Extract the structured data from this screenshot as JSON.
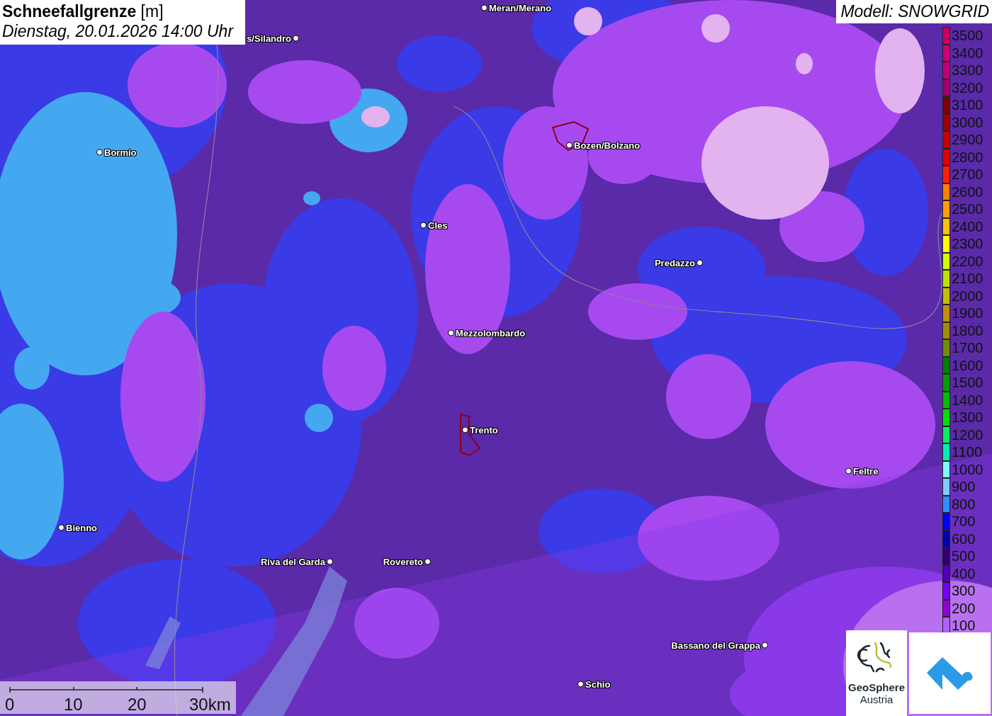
{
  "title": {
    "heading": "**Schneefallgrenze** [m]",
    "datetime": "Dienstag, 20.01.2026 14:00 Uhr"
  },
  "model": "Modell: SNOWGRID",
  "legend": [
    {
      "label": "3500",
      "color": "#c8005a"
    },
    {
      "label": "3400",
      "color": "#d0006e"
    },
    {
      "label": "3300",
      "color": "#c00070"
    },
    {
      "label": "3200",
      "color": "#a00070"
    },
    {
      "label": "3100",
      "color": "#800000"
    },
    {
      "label": "3000",
      "color": "#a00000"
    },
    {
      "label": "2900",
      "color": "#c80000"
    },
    {
      "label": "2800",
      "color": "#e00000"
    },
    {
      "label": "2700",
      "color": "#ff2000"
    },
    {
      "label": "2600",
      "color": "#ff8000"
    },
    {
      "label": "2500",
      "color": "#ffa000"
    },
    {
      "label": "2400",
      "color": "#ffc000"
    },
    {
      "label": "2300",
      "color": "#ffff00"
    },
    {
      "label": "2200",
      "color": "#d0ff00"
    },
    {
      "label": "2100",
      "color": "#c0e000"
    },
    {
      "label": "2000",
      "color": "#c0c000"
    },
    {
      "label": "1900",
      "color": "#c09000"
    },
    {
      "label": "1800",
      "color": "#a09000"
    },
    {
      "label": "1700",
      "color": "#709000"
    },
    {
      "label": "1600",
      "color": "#008000"
    },
    {
      "label": "1500",
      "color": "#00a000"
    },
    {
      "label": "1400",
      "color": "#00c000"
    },
    {
      "label": "1300",
      "color": "#00e000"
    },
    {
      "label": "1200",
      "color": "#00f060"
    },
    {
      "label": "1100",
      "color": "#00f0b0"
    },
    {
      "label": "1000",
      "color": "#80ffff"
    },
    {
      "label": "900",
      "color": "#80c8ff"
    },
    {
      "label": "800",
      "color": "#3090ff"
    },
    {
      "label": "700",
      "color": "#0000ff"
    },
    {
      "label": "600",
      "color": "#0000b0"
    },
    {
      "label": "500",
      "color": "#300070"
    },
    {
      "label": "400",
      "color": "#5000b0"
    },
    {
      "label": "300",
      "color": "#7000ff"
    },
    {
      "label": "200",
      "color": "#9000d0"
    },
    {
      "label": "100",
      "color": "#b060ff"
    }
  ],
  "cities": [
    {
      "name": "Meran/Merano",
      "kind": "label-right"
    },
    {
      "name": "s/Silandro",
      "kind": "label-left"
    },
    {
      "name": "Bormio",
      "kind": "label-right"
    },
    {
      "name": "Bozen/Bolzano",
      "kind": "label-right"
    },
    {
      "name": "Cles",
      "kind": "label-right"
    },
    {
      "name": "Predazzo",
      "kind": "label-left"
    },
    {
      "name": "Mezzolombardo",
      "kind": "label-right"
    },
    {
      "name": "Trento",
      "kind": "label-right"
    },
    {
      "name": "Feltre",
      "kind": "label-right"
    },
    {
      "name": "Bienno",
      "kind": "label-right"
    },
    {
      "name": "Riva del Garda",
      "kind": "label-left"
    },
    {
      "name": "Rovereto",
      "kind": "label-left"
    },
    {
      "name": "Bassano del Grappa",
      "kind": "label-left"
    },
    {
      "name": "Schio",
      "kind": "label-right"
    }
  ],
  "scale_bar": {
    "ticks": [
      "0",
      "10",
      "20",
      "30km"
    ]
  },
  "logos": [
    {
      "kind": "geosphere",
      "line_1": "GeoSphere",
      "line_2": "Austria"
    },
    {
      "kind": "app"
    }
  ]
}
